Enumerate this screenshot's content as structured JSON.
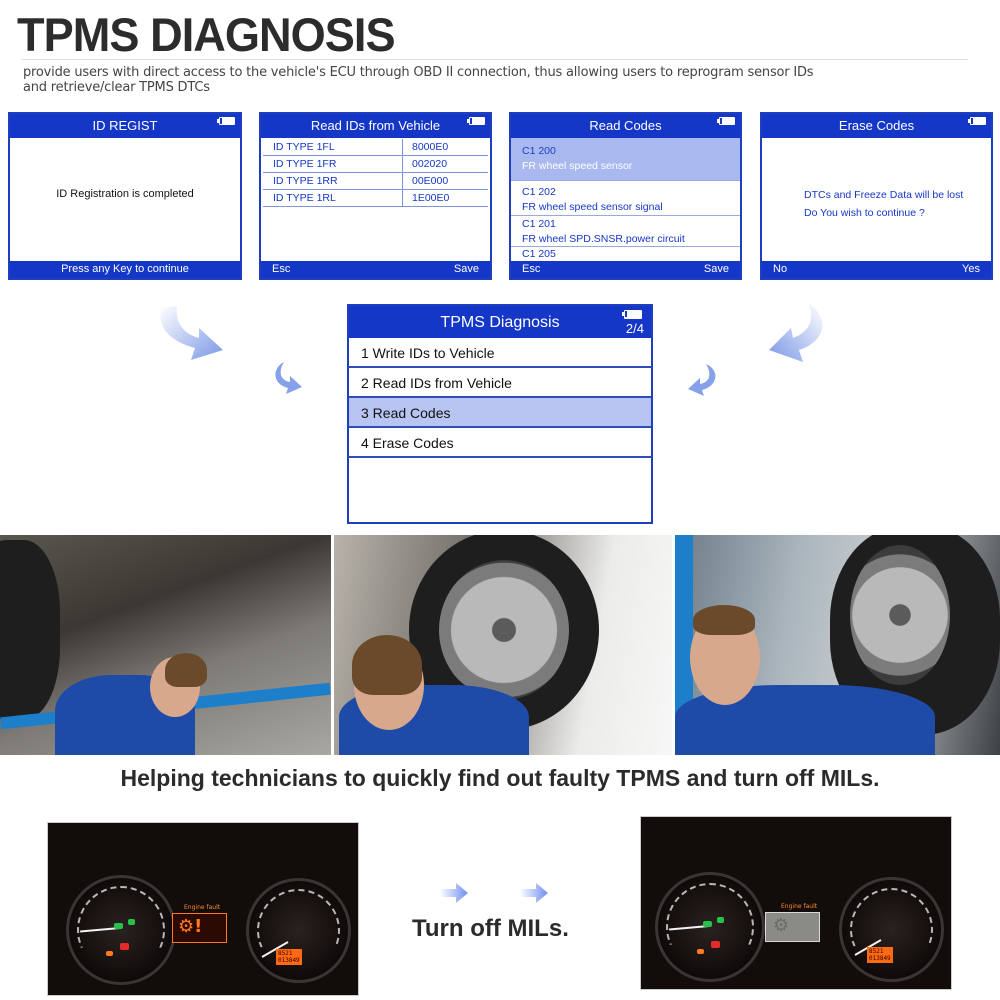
{
  "header": {
    "title": "TPMS DIAGNOSIS",
    "subtitle": "provide users with direct access to the vehicle's ECU through OBD II connection, thus allowing users to reprogram sensor IDs and retrieve/clear TPMS DTCs"
  },
  "screens": {
    "id_regist": {
      "title": "ID REGIST",
      "message": "ID Registration is completed",
      "footer": "Press any Key to continue"
    },
    "read_ids": {
      "title": "Read IDs from Vehicle",
      "rows": [
        {
          "label": "ID TYPE 1FL",
          "value": "8000E0"
        },
        {
          "label": "ID TYPE 1FR",
          "value": "002020"
        },
        {
          "label": "ID TYPE 1RR",
          "value": "00E000"
        },
        {
          "label": "ID TYPE 1RL",
          "value": "1E00E0"
        }
      ],
      "footer_left": "Esc",
      "footer_right": "Save"
    },
    "read_codes": {
      "title": "Read Codes",
      "codes": [
        {
          "code": "C1 200",
          "desc": "FR wheel speed sensor",
          "selected": true
        },
        {
          "code": "C1 202",
          "desc": "FR wheel speed sensor signal",
          "selected": false
        },
        {
          "code": "C1 201",
          "desc": "FR wheel SPD.SNSR.power circuit",
          "selected": false
        },
        {
          "code": "C1 205",
          "desc": "",
          "selected": false
        }
      ],
      "footer_left": "Esc",
      "footer_right": "Save"
    },
    "erase_codes": {
      "title": "Erase Codes",
      "line1": "DTCs and Freeze Data will be lost",
      "line2": "Do You wish to continue ?",
      "footer_left": "No",
      "footer_right": "Yes"
    }
  },
  "menu": {
    "title": "TPMS Diagnosis",
    "page": "2/4",
    "items": [
      {
        "label": "1 Write IDs to Vehicle",
        "selected": false
      },
      {
        "label": "2 Read IDs from Vehicle",
        "selected": false
      },
      {
        "label": "3 Read Codes",
        "selected": true
      },
      {
        "label": "4 Erase Codes",
        "selected": false
      }
    ]
  },
  "icons": {
    "battery": "battery-icon",
    "flow_arrow": "curved-arrow-icon",
    "right_arrow": "right-arrow-icon"
  },
  "photos": [
    {
      "name": "technician-under-car-photo",
      "description": "Technician inspecting car underside on lift"
    },
    {
      "name": "technician-wheel-wrench-photo",
      "description": "Technician tightening wheel lug nuts"
    },
    {
      "name": "technician-holding-tire-photo",
      "description": "Smiling technician holding a tire"
    }
  ],
  "tagline": "Helping technicians to quickly find out faulty TPMS and turn off MILs.",
  "dashboards": {
    "before": {
      "lcd_text": "Engine fault",
      "mil_on": true
    },
    "after": {
      "lcd_text": "Engine fault",
      "mil_on": false
    },
    "caption": "Turn off MILs."
  },
  "colors": {
    "screen_blue": "#1537c8",
    "selected_row": "#b8c5f2",
    "arrow_blue": "#7a97e6",
    "title_text": "#2c2c2c"
  }
}
